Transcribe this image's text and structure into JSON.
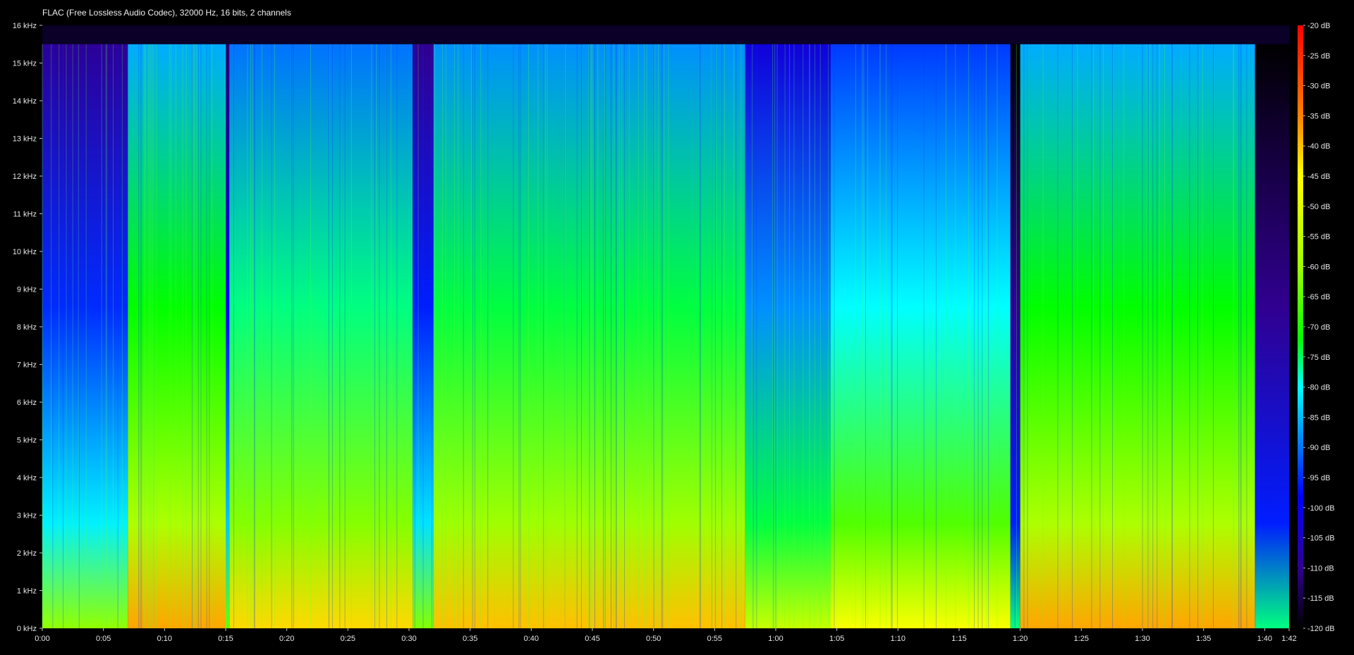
{
  "file_info": "FLAC (Free Lossless Audio Codec), 32000 Hz, 16 bits, 2 channels",
  "chart_data": {
    "type": "heatmap",
    "title": "",
    "xlabel": "",
    "ylabel": "",
    "x_unit": "time (m:ss)",
    "y_unit": "kHz",
    "xlim_seconds": [
      0,
      102
    ],
    "ylim_khz": [
      0,
      16
    ],
    "x_tick_labels": [
      "0:00",
      "0:05",
      "0:10",
      "0:15",
      "0:20",
      "0:25",
      "0:30",
      "0:35",
      "0:40",
      "0:45",
      "0:50",
      "0:55",
      "1:00",
      "1:05",
      "1:10",
      "1:15",
      "1:20",
      "1:25",
      "1:30",
      "1:35",
      "1:40",
      "1:42"
    ],
    "x_tick_seconds": [
      0,
      5,
      10,
      15,
      20,
      25,
      30,
      35,
      40,
      45,
      50,
      55,
      60,
      65,
      70,
      75,
      80,
      85,
      90,
      95,
      100,
      102
    ],
    "y_tick_labels": [
      "0 kHz",
      "1 kHz",
      "2 kHz",
      "3 kHz",
      "4 kHz",
      "5 kHz",
      "6 kHz",
      "7 kHz",
      "8 kHz",
      "9 kHz",
      "10 kHz",
      "11 kHz",
      "12 kHz",
      "13 kHz",
      "14 kHz",
      "15 kHz",
      "16 kHz"
    ],
    "y_tick_khz": [
      0,
      1,
      2,
      3,
      4,
      5,
      6,
      7,
      8,
      9,
      10,
      11,
      12,
      13,
      14,
      15,
      16
    ],
    "colorbar": {
      "range_db": [
        -120,
        -20
      ],
      "tick_labels": [
        "-20 dB",
        "-25 dB",
        "-30 dB",
        "-35 dB",
        "-40 dB",
        "-45 dB",
        "-50 dB",
        "-55 dB",
        "-60 dB",
        "-65 dB",
        "-70 dB",
        "-75 dB",
        "-80 dB",
        "-85 dB",
        "-90 dB",
        "-95 dB",
        "-100 dB",
        "-105 dB",
        "-110 dB",
        "-115 dB",
        "-120 dB"
      ],
      "tick_db": [
        -20,
        -25,
        -30,
        -35,
        -40,
        -45,
        -50,
        -55,
        -60,
        -65,
        -70,
        -75,
        -80,
        -85,
        -90,
        -95,
        -100,
        -105,
        -110,
        -115,
        -120
      ],
      "stops": [
        {
          "db": -20,
          "color": "#ff0000"
        },
        {
          "db": -35,
          "color": "#ff8000"
        },
        {
          "db": -45,
          "color": "#ffff00"
        },
        {
          "db": -60,
          "color": "#a0ff00"
        },
        {
          "db": -72,
          "color": "#00ff00"
        },
        {
          "db": -80,
          "color": "#00ffff"
        },
        {
          "db": -88,
          "color": "#0090ff"
        },
        {
          "db": -98,
          "color": "#0000ff"
        },
        {
          "db": -110,
          "color": "#300090"
        },
        {
          "db": -120,
          "color": "#000000"
        }
      ]
    },
    "cutoff_khz": 15.5,
    "segments": [
      {
        "start_s": 0.0,
        "end_s": 7.0,
        "level_db": -95,
        "top_khz": 15.5
      },
      {
        "start_s": 7.0,
        "end_s": 15.0,
        "level_db": -72,
        "top_khz": 15.5
      },
      {
        "start_s": 15.0,
        "end_s": 15.3,
        "level_db": -98,
        "top_khz": 15.5
      },
      {
        "start_s": 15.3,
        "end_s": 30.3,
        "level_db": -76,
        "top_khz": 15.5
      },
      {
        "start_s": 30.3,
        "end_s": 32.0,
        "level_db": -96,
        "top_khz": 15.5
      },
      {
        "start_s": 32.0,
        "end_s": 57.5,
        "level_db": -74,
        "top_khz": 15.5
      },
      {
        "start_s": 57.5,
        "end_s": 64.5,
        "level_db": -88,
        "top_khz": 15.5
      },
      {
        "start_s": 64.5,
        "end_s": 79.2,
        "level_db": -80,
        "top_khz": 15.5
      },
      {
        "start_s": 79.2,
        "end_s": 80.0,
        "level_db": -110,
        "top_khz": 15.5
      },
      {
        "start_s": 80.0,
        "end_s": 99.2,
        "level_db": -72,
        "top_khz": 15.5
      },
      {
        "start_s": 99.2,
        "end_s": 102.0,
        "level_db": -110,
        "top_khz": 15.5
      }
    ]
  }
}
